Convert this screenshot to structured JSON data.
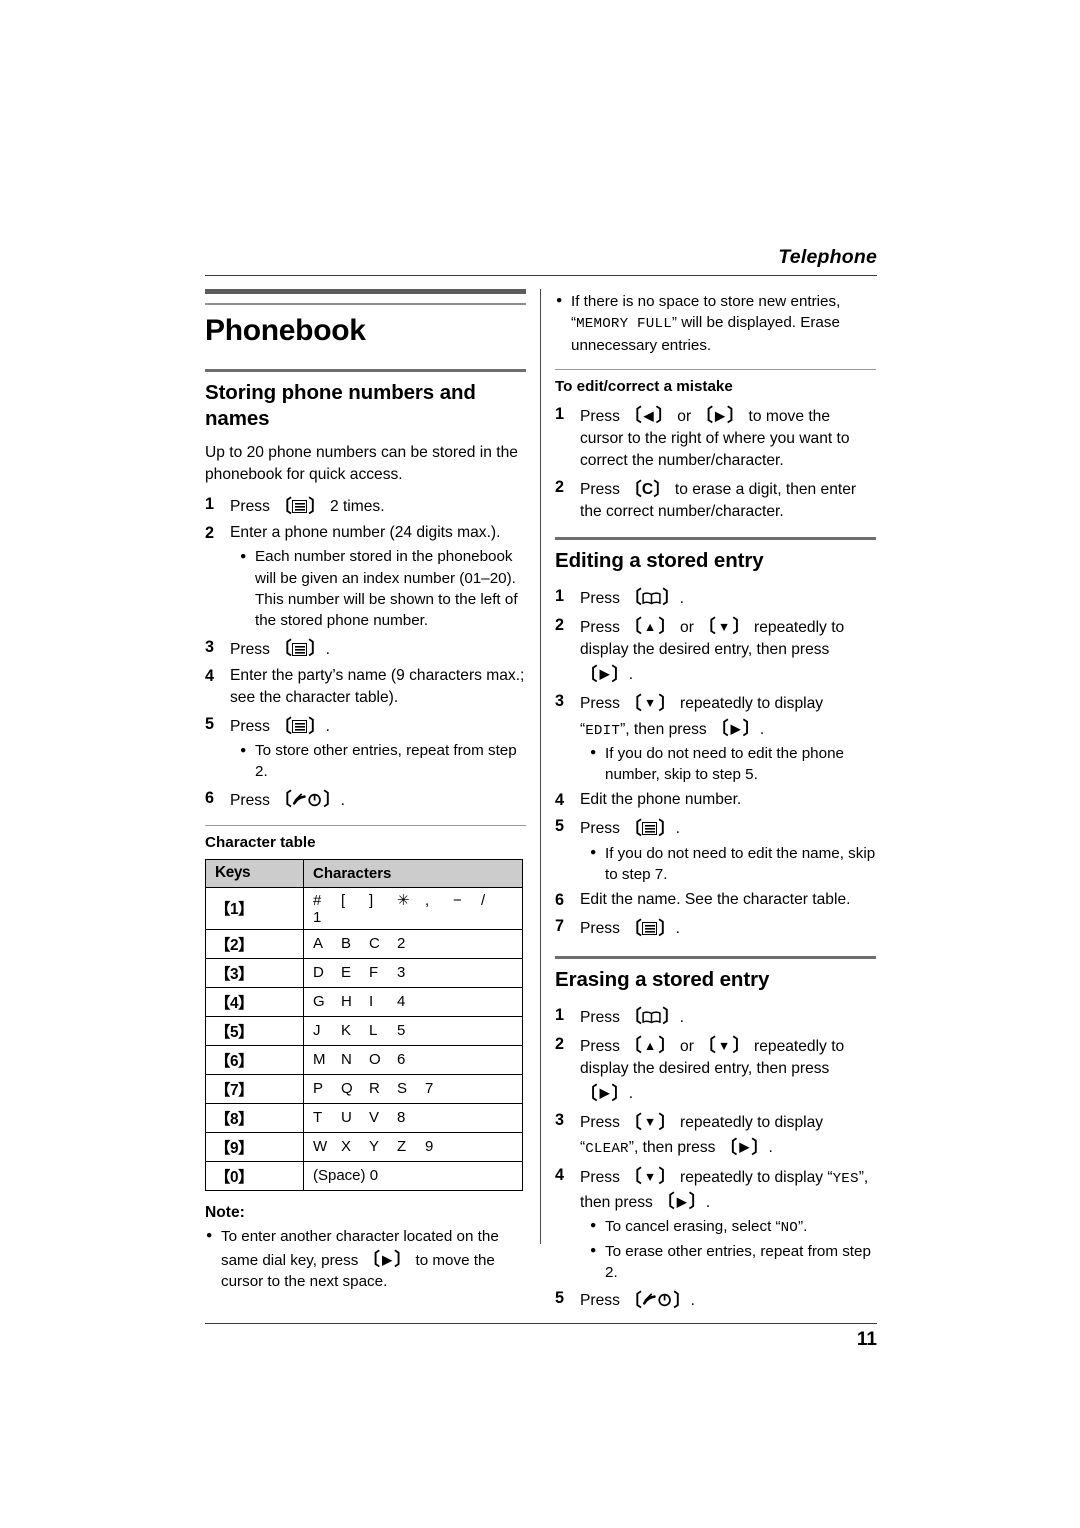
{
  "header": {
    "running_head": "Telephone"
  },
  "footer": {
    "page_number": "11"
  },
  "chapter": {
    "title": "Phonebook"
  },
  "left_column": {
    "section1": {
      "title": "Storing phone numbers and names",
      "intro": "Up to 20 phone numbers can be stored in the phonebook for quick access.",
      "steps": [
        {
          "num": "1",
          "pre": "Press ",
          "key": "menu-icon",
          "post": " 2 times."
        },
        {
          "num": "2",
          "pre": "Enter a phone number (24 digits max.).",
          "key": "",
          "post": "",
          "bullets": [
            "Each number stored in the phonebook will be given an index number (01–20). This number will be shown to the left of the stored phone number."
          ]
        },
        {
          "num": "3",
          "pre": "Press ",
          "key": "menu-icon",
          "post": "."
        },
        {
          "num": "4",
          "pre": "Enter the party’s name (9 characters max.; see the character table).",
          "key": "",
          "post": ""
        },
        {
          "num": "5",
          "pre": "Press ",
          "key": "menu-icon",
          "post": ".",
          "bullets": [
            "To store other entries, repeat from step 2."
          ]
        },
        {
          "num": "6",
          "pre": "Press ",
          "key": "power-icon",
          "post": "."
        }
      ]
    },
    "char_table": {
      "caption": "Character table",
      "columns": [
        "Keys",
        "Characters"
      ],
      "rows": [
        {
          "key": "【1】",
          "chars": [
            "#",
            "[",
            "]",
            "✳",
            ",",
            "−",
            "/",
            "1"
          ]
        },
        {
          "key": "【2】",
          "chars": [
            "A",
            "B",
            "C",
            "2"
          ]
        },
        {
          "key": "【3】",
          "chars": [
            "D",
            "E",
            "F",
            "3"
          ]
        },
        {
          "key": "【4】",
          "chars": [
            "G",
            "H",
            "I",
            "4"
          ]
        },
        {
          "key": "【5】",
          "chars": [
            "J",
            "K",
            "L",
            "5"
          ]
        },
        {
          "key": "【6】",
          "chars": [
            "M",
            "N",
            "O",
            "6"
          ]
        },
        {
          "key": "【7】",
          "chars": [
            "P",
            "Q",
            "R",
            "S",
            "7"
          ]
        },
        {
          "key": "【8】",
          "chars": [
            "T",
            "U",
            "V",
            "8"
          ]
        },
        {
          "key": "【9】",
          "chars": [
            "W",
            "X",
            "Y",
            "Z",
            "9"
          ]
        },
        {
          "key": "【0】",
          "chars": [
            "(Space) 0"
          ]
        }
      ]
    },
    "note": {
      "head": "Note:",
      "bullet_pre": "To enter another character located on the same dial key, press ",
      "bullet_key": "right-arrow-key",
      "bullet_post": " to move the cursor to the next space."
    }
  },
  "right_column": {
    "top_bullet": {
      "pre": "If there is no space to store new entries, “",
      "lcd": "MEMORY FULL",
      "post": "” will be displayed. Erase unnecessary entries."
    },
    "subsection": {
      "title": "To edit/correct a mistake",
      "steps": [
        {
          "num": "1",
          "pre": "Press ",
          "key_a": "left-arrow-key",
          "mid": " or ",
          "key_b": "right-arrow-key",
          "post": " to move the cursor to the right of where you want to correct the number/character."
        },
        {
          "num": "2",
          "pre": "Press ",
          "key_a": "C-key",
          "post": " to erase a digit, then enter the correct number/character."
        }
      ]
    },
    "section2": {
      "title": "Editing a stored entry",
      "steps": [
        {
          "num": "1",
          "pre": "Press ",
          "key_a": "phonebook-icon",
          "post": "."
        },
        {
          "num": "2",
          "pre": "Press ",
          "key_a": "up-arrow-key",
          "mid": " or ",
          "key_b": "down-arrow-key",
          "post": " repeatedly to display the desired entry, then press ",
          "key_c": "right-arrow-key",
          "tail": "."
        },
        {
          "num": "3",
          "pre": "Press ",
          "key_a": "down-arrow-key",
          "mid": " repeatedly to display “",
          "lcd": "EDIT",
          "post": "”, then press ",
          "key_c": "right-arrow-key",
          "tail": ".",
          "bullets": [
            "If you do not need to edit the phone number, skip to step 5."
          ]
        },
        {
          "num": "4",
          "pre": "Edit the phone number."
        },
        {
          "num": "5",
          "pre": "Press ",
          "key_a": "menu-icon",
          "post": ".",
          "bullets": [
            "If you do not need to edit the name, skip to step 7."
          ]
        },
        {
          "num": "6",
          "pre": "Edit the name. See the character table."
        },
        {
          "num": "7",
          "pre": "Press ",
          "key_a": "menu-icon",
          "post": "."
        }
      ]
    },
    "section3": {
      "title": "Erasing a stored entry",
      "steps": [
        {
          "num": "1",
          "pre": "Press ",
          "key_a": "phonebook-icon",
          "post": "."
        },
        {
          "num": "2",
          "pre": "Press ",
          "key_a": "up-arrow-key",
          "mid": " or ",
          "key_b": "down-arrow-key",
          "post": " repeatedly to display the desired entry, then press ",
          "key_c": "right-arrow-key",
          "tail": "."
        },
        {
          "num": "3",
          "pre": "Press ",
          "key_a": "down-arrow-key",
          "mid": " repeatedly to display “",
          "lcd": "CLEAR",
          "post": "”, then press ",
          "key_c": "right-arrow-key",
          "tail": "."
        },
        {
          "num": "4",
          "pre": "Press ",
          "key_a": "down-arrow-key",
          "mid": " repeatedly to display “",
          "lcd": "YES",
          "post": "”, then press ",
          "key_c": "right-arrow-key",
          "tail": ".",
          "bullets_rich": [
            {
              "pre": "To cancel erasing, select “",
              "lcd": "NO",
              "post": "”."
            },
            {
              "pre": "To erase other entries, repeat from step 2.",
              "lcd": "",
              "post": ""
            }
          ]
        },
        {
          "num": "5",
          "pre": "Press ",
          "key_a": "power-icon",
          "post": "."
        }
      ]
    }
  },
  "strings": {
    "s_intro": "Up to 20 phone numbers can be stored in the phonebook for quick access.",
    "press": "Press ",
    "two_times": " 2 times.",
    "period": ".",
    "step2_text": "Enter a phone number (24 digits max.).",
    "step2_bullet": "Each number stored in the phonebook will be given an index number (01–20). This number will be shown to the left of the stored phone number.",
    "step4_text": "Enter the party’s name (9 characters max.; see the character table).",
    "step5_bullet": "To store other entries, repeat from step 2.",
    "note_head": "Note:",
    "note_pre": "To enter another character located on the same dial key, press ",
    "note_post": " to move the cursor to the next space.",
    "rb_pre": "If there is no space to store new entries, “",
    "rb_lcd": "MEMORY FULL",
    "rb_post": "” will be displayed. Erase unnecessary entries.",
    "sub_title": "To edit/correct a mistake",
    "e1_pre": "Press ",
    "e1_mid": " or ",
    "e1_post": " to move the cursor to the right of where you want to correct the number/character.",
    "e2_pre": "Press ",
    "e2_post": " to erase a digit, then enter the correct number/character.",
    "c_key_letter": "C",
    "sec2_title": "Editing a stored entry",
    "or_text": " or ",
    "rep_display": " repeatedly to display the desired entry, then press ",
    "rep_display2": " repeatedly to display “",
    "then_press": "”, then press ",
    "lcd_edit": "EDIT",
    "lcd_clear": "CLEAR",
    "lcd_yes": "YES",
    "lcd_no": "NO",
    "b_skip5": "If you do not need to edit the phone number, skip to step 5.",
    "s4_edit_number": "Edit the phone number.",
    "b_skip7": "If you do not need to edit the name, skip to step 7.",
    "s6_edit_name": "Edit the name. See the character table.",
    "sec3_title": "Erasing a stored entry",
    "b_cancel_pre": "To cancel erasing, select “",
    "b_cancel_post": "”.",
    "b_repeat": "To erase other entries, repeat from step 2.",
    "tbl_caption": "Character table",
    "tbl_keys": "Keys",
    "tbl_chars": "Characters"
  },
  "colors": {
    "text": "#000000",
    "rule_dark": "#3a3a3a",
    "rule_gray": "#6e6e6e",
    "table_header_bg": "#cccccc"
  }
}
